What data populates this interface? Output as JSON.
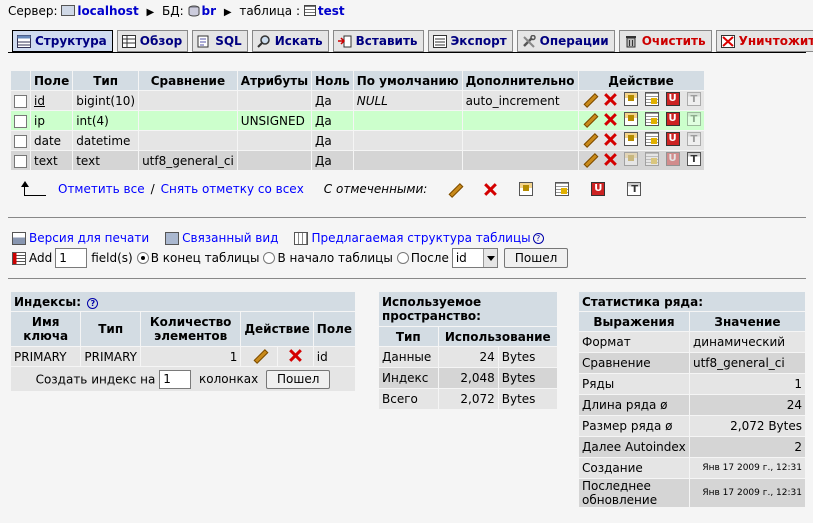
{
  "breadcrumb": {
    "server_label": "Сервер:",
    "server": "localhost",
    "db_label": "БД:",
    "db": "br",
    "table_label": "таблица :",
    "table": "test"
  },
  "tabs": [
    {
      "label": "Структура",
      "icon": "structure-icon",
      "active": true
    },
    {
      "label": "Обзор",
      "icon": "browse-icon"
    },
    {
      "label": "SQL",
      "icon": "sql-icon"
    },
    {
      "label": "Искать",
      "icon": "search-icon"
    },
    {
      "label": "Вставить",
      "icon": "insert-icon"
    },
    {
      "label": "Экспорт",
      "icon": "export-icon"
    },
    {
      "label": "Операции",
      "icon": "operations-icon"
    },
    {
      "label": "Очистить",
      "icon": "empty-icon"
    },
    {
      "label": "Уничтожить",
      "icon": "drop-icon"
    }
  ],
  "structure": {
    "headers": {
      "field": "Поле",
      "type": "Тип",
      "collation": "Сравнение",
      "attributes": "Атрибуты",
      "null": "Ноль",
      "default": "По умолчанию",
      "extra": "Дополнительно",
      "action": "Действие"
    },
    "rows": [
      {
        "field": "id",
        "type": "bigint(10)",
        "collation": "",
        "attributes": "",
        "null": "Да",
        "default": "NULL",
        "extra": "auto_increment"
      },
      {
        "field": "ip",
        "type": "int(4)",
        "collation": "",
        "attributes": "UNSIGNED",
        "null": "Да",
        "default": "",
        "extra": ""
      },
      {
        "field": "date",
        "type": "datetime",
        "collation": "",
        "attributes": "",
        "null": "Да",
        "default": "",
        "extra": ""
      },
      {
        "field": "text",
        "type": "text",
        "collation": "utf8_general_ci",
        "attributes": "",
        "null": "Да",
        "default": "",
        "extra": ""
      }
    ]
  },
  "checkall": {
    "check_all": "Отметить все",
    "separator": "/",
    "uncheck_all": "Снять отметку со всех",
    "with_selected": "С отмеченными:"
  },
  "links": {
    "print": "Версия для печати",
    "relation": "Связанный вид",
    "propose": "Предлагаемая структура таблицы"
  },
  "add": {
    "label": "Add",
    "count": "1",
    "fields_label": "field(s)",
    "end_of_table": "В конец таблицы",
    "start_of_table": "В начало таблицы",
    "after": "После",
    "after_field": "id",
    "go": "Пошел"
  },
  "indexes": {
    "title": "Индексы:",
    "headers": {
      "keyname": "Имя ключа",
      "type": "Тип",
      "cardinality": "Количество элементов",
      "action": "Действие",
      "field": "Поле"
    },
    "rows": [
      {
        "keyname": "PRIMARY",
        "type": "PRIMARY",
        "cardinality": "1",
        "field": "id"
      }
    ],
    "create_prefix": "Создать индекс на",
    "create_count": "1",
    "create_suffix": "колонках",
    "go": "Пошел"
  },
  "space": {
    "title": "Используемое пространство:",
    "headers": {
      "type": "Тип",
      "usage": "Использование"
    },
    "rows": [
      {
        "type": "Данные",
        "value": "24",
        "unit": "Bytes"
      },
      {
        "type": "Индекс",
        "value": "2,048",
        "unit": "Bytes"
      },
      {
        "type": "Всего",
        "value": "2,072",
        "unit": "Bytes"
      }
    ]
  },
  "stats": {
    "title": "Статистика ряда:",
    "headers": {
      "statement": "Выражения",
      "value": "Значение"
    },
    "rows": [
      {
        "label": "Формат",
        "value": "динамический"
      },
      {
        "label": "Сравнение",
        "value": "utf8_general_ci"
      },
      {
        "label": "Ряды",
        "value": "1"
      },
      {
        "label": "Длина ряда ø",
        "value": "24"
      },
      {
        "label": "Размер ряда ø",
        "value": "2,072 Bytes"
      },
      {
        "label": "Далее Autoindex",
        "value": "2"
      },
      {
        "label": "Создание",
        "value": "Янв 17 2009 г., 12:31"
      },
      {
        "label": "Последнее обновление",
        "value": "Янв 17 2009 г., 12:31"
      }
    ]
  }
}
